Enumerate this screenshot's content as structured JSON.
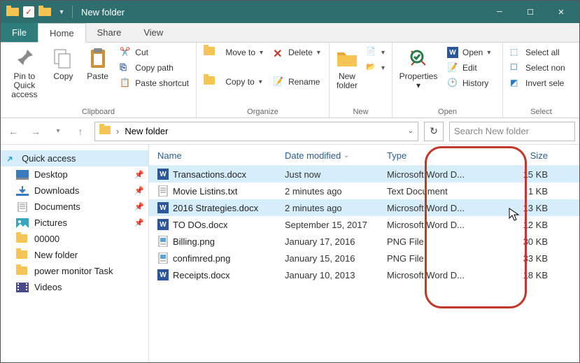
{
  "window": {
    "title": "New folder"
  },
  "tabs": {
    "file": "File",
    "home": "Home",
    "share": "Share",
    "view": "View"
  },
  "ribbon": {
    "pin": "Pin to Quick\naccess",
    "copy": "Copy",
    "paste": "Paste",
    "cut": "Cut",
    "copypath": "Copy path",
    "pasteshort": "Paste shortcut",
    "clipboard_label": "Clipboard",
    "moveto": "Move to",
    "copyto": "Copy to",
    "delete": "Delete",
    "rename": "Rename",
    "organize_label": "Organize",
    "newfolder": "New\nfolder",
    "newitem": "New item",
    "easyaccess": "Easy access",
    "new_label": "New",
    "properties": "Properties",
    "open": "Open",
    "edit": "Edit",
    "history": "History",
    "open_label": "Open",
    "selectall": "Select all",
    "selectnone": "Select non",
    "invert": "Invert sele",
    "select_label": "Select"
  },
  "breadcrumb": {
    "folder": "New folder"
  },
  "search": {
    "placeholder": "Search New folder"
  },
  "sidebar": {
    "quick_access": "Quick access",
    "items": [
      {
        "label": "Desktop",
        "icon": "desktop",
        "pinned": true
      },
      {
        "label": "Downloads",
        "icon": "download",
        "pinned": true
      },
      {
        "label": "Documents",
        "icon": "document",
        "pinned": true
      },
      {
        "label": "Pictures",
        "icon": "picture",
        "pinned": true
      },
      {
        "label": "00000",
        "icon": "folder",
        "pinned": false
      },
      {
        "label": "New folder",
        "icon": "folder",
        "pinned": false
      },
      {
        "label": "power monitor Task",
        "icon": "folder",
        "pinned": false
      },
      {
        "label": "Videos",
        "icon": "video",
        "pinned": false
      }
    ]
  },
  "columns": {
    "name": "Name",
    "date": "Date modified",
    "type": "Type",
    "size": "Size"
  },
  "files": [
    {
      "name": "Transactions.docx",
      "date": "Just now",
      "type": "Microsoft Word D...",
      "size": "15 KB",
      "icon": "word",
      "selected": true
    },
    {
      "name": "Movie Listins.txt",
      "date": "2 minutes ago",
      "type": "Text Document",
      "size": "1 KB",
      "icon": "text",
      "selected": false
    },
    {
      "name": "2016 Strategies.docx",
      "date": "2 minutes ago",
      "type": "Microsoft Word D...",
      "size": "13 KB",
      "icon": "word",
      "selected": true
    },
    {
      "name": "TO DOs.docx",
      "date": "September 15, 2017",
      "type": "Microsoft Word D...",
      "size": "12 KB",
      "icon": "word",
      "selected": false
    },
    {
      "name": "Billing.png",
      "date": "January 17, 2016",
      "type": "PNG File",
      "size": "30 KB",
      "icon": "image",
      "selected": false
    },
    {
      "name": "confimred.png",
      "date": "January 15, 2016",
      "type": "PNG File",
      "size": "33 KB",
      "icon": "image",
      "selected": false
    },
    {
      "name": "Receipts.docx",
      "date": "January 10, 2013",
      "type": "Microsoft Word D...",
      "size": "18 KB",
      "icon": "word",
      "selected": false
    }
  ]
}
